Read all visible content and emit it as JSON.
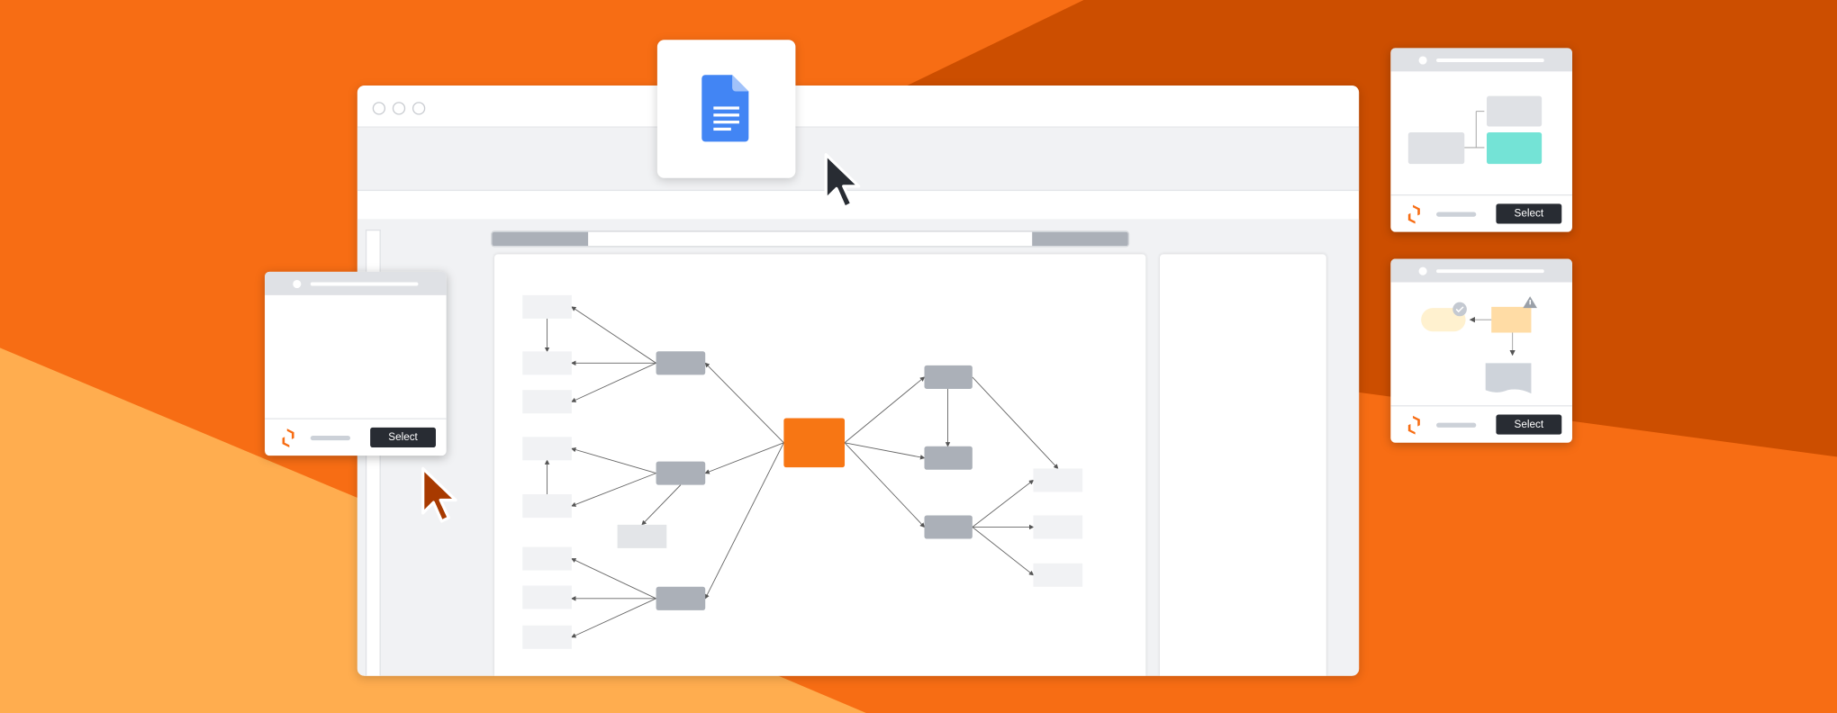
{
  "colors": {
    "background": "#F76D14",
    "background_dark": "#CC4E00",
    "background_light": "#FFAD4F",
    "accent": "#F77614",
    "node_gray": "#ABB0B8",
    "node_light": "#F1F2F4",
    "teal": "#74E3D6",
    "button": "#282C33",
    "doc_blue": "#4285F4"
  },
  "popups": [
    {
      "button_label": "Select"
    },
    {
      "button_label": "Select"
    },
    {
      "button_label": "Select"
    }
  ],
  "icons": [
    "google-docs-icon",
    "mouse-cursor-icon",
    "lucid-logo-icon",
    "check-icon",
    "warning-icon"
  ]
}
